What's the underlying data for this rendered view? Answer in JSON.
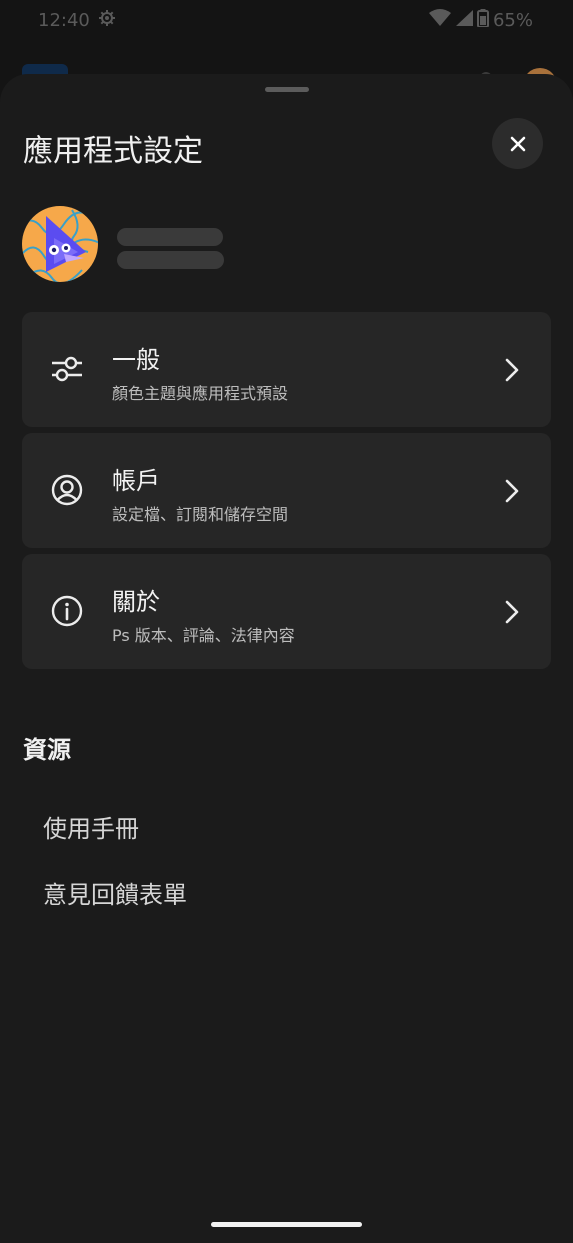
{
  "status_bar": {
    "time": "12:40",
    "battery": "65%",
    "settings_icon": "gear-icon",
    "wifi_icon": "wifi-icon",
    "signal_icon": "signal-icon",
    "battery_icon": "battery-icon"
  },
  "sheet": {
    "title": "應用程式設定",
    "close_icon": "close-icon"
  },
  "profile": {
    "avatar_icon": "avatar-illustration"
  },
  "menu": {
    "items": [
      {
        "title": "一般",
        "subtitle": "顏色主題與應用程式預設",
        "icon": "sliders-icon"
      },
      {
        "title": "帳戶",
        "subtitle": "設定檔、訂閱和儲存空間",
        "icon": "account-circle-icon"
      },
      {
        "title": "關於",
        "subtitle": "Ps 版本、評論、法律內容",
        "icon": "info-icon"
      }
    ],
    "chevron_icon": "chevron-right-icon"
  },
  "resources": {
    "title": "資源",
    "links": [
      {
        "label": "使用手冊"
      },
      {
        "label": "意見回饋表單"
      }
    ]
  },
  "colors": {
    "background": "#1b1b1b",
    "card": "#262626",
    "avatar_bg": "#f6a84a",
    "avatar_accent": "#5b4cf0"
  }
}
